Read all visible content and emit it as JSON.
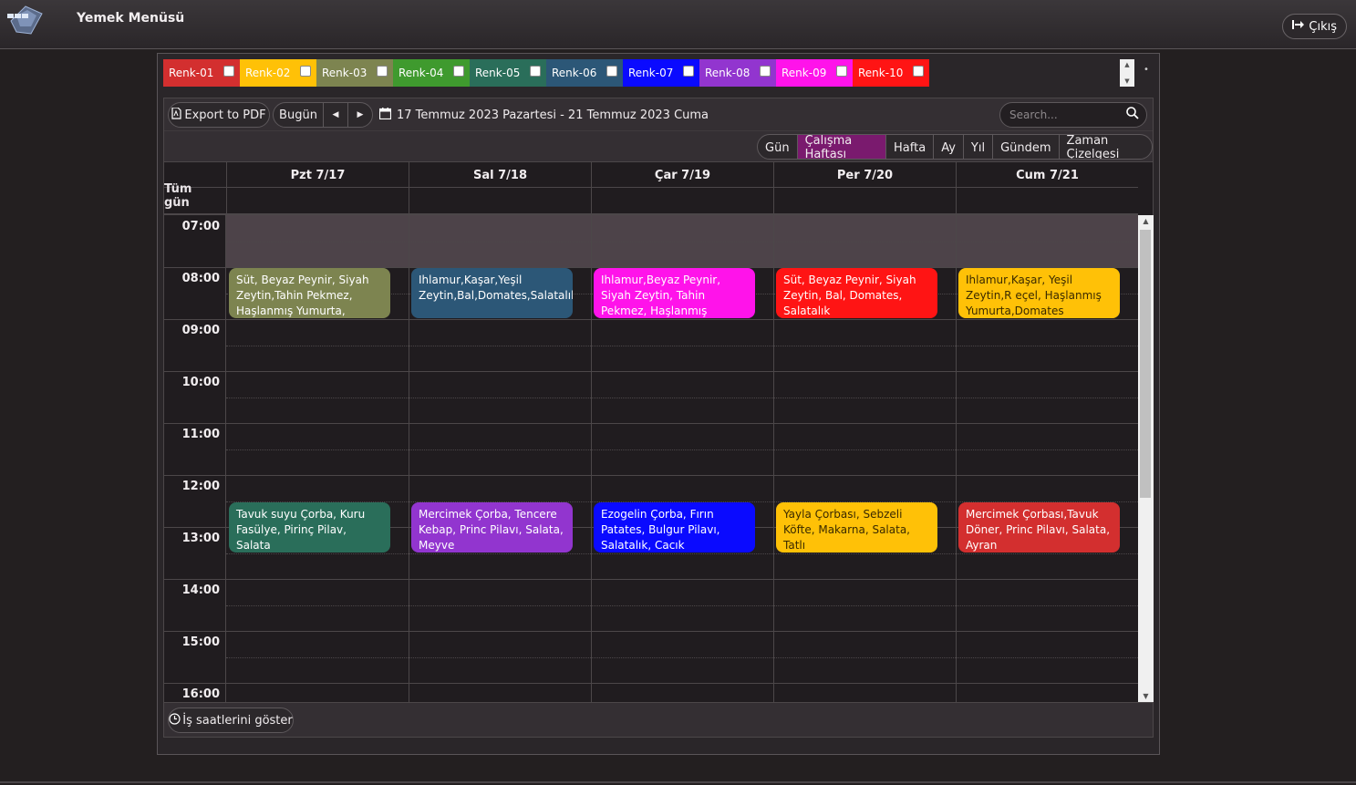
{
  "app": {
    "title": "Yemek Menüsü",
    "logout_label": "Çıkış"
  },
  "colors": [
    {
      "label": "Renk-01",
      "color": "#d32f2f"
    },
    {
      "label": "Renk-02",
      "color": "#ffc107"
    },
    {
      "label": "Renk-03",
      "color": "#7d8450"
    },
    {
      "label": "Renk-04",
      "color": "#3f9a2e"
    },
    {
      "label": "Renk-05",
      "color": "#2a6e5a"
    },
    {
      "label": "Renk-06",
      "color": "#2c5777"
    },
    {
      "label": "Renk-07",
      "color": "#0a0aff"
    },
    {
      "label": "Renk-08",
      "color": "#9235cf"
    },
    {
      "label": "Renk-09",
      "color": "#ff13ea"
    },
    {
      "label": "Renk-10",
      "color": "#ff1414"
    }
  ],
  "toolbar": {
    "export_label": "Export to PDF",
    "today_label": "Bugün",
    "date_range": "17 Temmuz 2023 Pazartesi - 21 Temmuz 2023 Cuma",
    "search_placeholder": "Search..."
  },
  "views": [
    {
      "label": "Gün",
      "active": false
    },
    {
      "label": "Çalışma Haftası",
      "active": true
    },
    {
      "label": "Hafta",
      "active": false
    },
    {
      "label": "Ay",
      "active": false
    },
    {
      "label": "Yıl",
      "active": false
    },
    {
      "label": "Gündem",
      "active": false
    },
    {
      "label": "Zaman Çizelgesi",
      "active": false
    }
  ],
  "days": [
    "Pzt 7/17",
    "Sal 7/18",
    "Çar 7/19",
    "Per 7/20",
    "Cum 7/21"
  ],
  "allday_label": "Tüm gün",
  "hours": [
    "07:00",
    "08:00",
    "09:00",
    "10:00",
    "11:00",
    "12:00",
    "13:00",
    "14:00",
    "15:00",
    "16:00"
  ],
  "events": [
    {
      "day": 0,
      "start": 8,
      "end": 9,
      "color": "#7d8450",
      "text": "Süt, Beyaz Peynir, Siyah Zeytin,Tahin Pekmez, Haşlanmış Yumurta,"
    },
    {
      "day": 1,
      "start": 8,
      "end": 9,
      "color": "#2c5777",
      "text": "Ihlamur,Kaşar,Yeşil Zeytin,Bal,Domates,Salatalık"
    },
    {
      "day": 2,
      "start": 8,
      "end": 9,
      "color": "#ff13ea",
      "text": "Ihlamur,Beyaz Peynir, Siyah Zeytin, Tahin Pekmez, Haşlanmış"
    },
    {
      "day": 3,
      "start": 8,
      "end": 9,
      "color": "#ff1414",
      "text": "Süt, Beyaz Peynir, Siyah Zeytin, Bal, Domates, Salatalık"
    },
    {
      "day": 4,
      "start": 8,
      "end": 9,
      "color": "#ffc107",
      "text": "Ihlamur,Kaşar, Yeşil Zeytin,R eçel, Haşlanmış Yumurta,Domates"
    },
    {
      "day": 0,
      "start": 12.5,
      "end": 13.5,
      "color": "#2a6e5a",
      "text": "Tavuk suyu Çorba, Kuru Fasülye, Pirinç Pilav, Salata"
    },
    {
      "day": 1,
      "start": 12.5,
      "end": 13.5,
      "color": "#9235cf",
      "text": "Mercimek Çorba, Tencere Kebap, Princ Pilavı, Salata, Meyve"
    },
    {
      "day": 2,
      "start": 12.5,
      "end": 13.5,
      "color": "#0a0aff",
      "text": "Ezogelin Çorba, Fırın Patates, Bulgur Pilavı, Salatalık, Cacık"
    },
    {
      "day": 3,
      "start": 12.5,
      "end": 13.5,
      "color": "#ffc107",
      "text": "Yayla Çorbası, Sebzeli Köfte, Makarna, Salata, Tatlı"
    },
    {
      "day": 4,
      "start": 12.5,
      "end": 13.5,
      "color": "#d32f2f",
      "text": "Mercimek Çorbası,Tavuk Döner, Princ Pilavı, Salata, Ayran"
    }
  ],
  "footer": {
    "business_hours_label": "İş saatlerini göster"
  }
}
